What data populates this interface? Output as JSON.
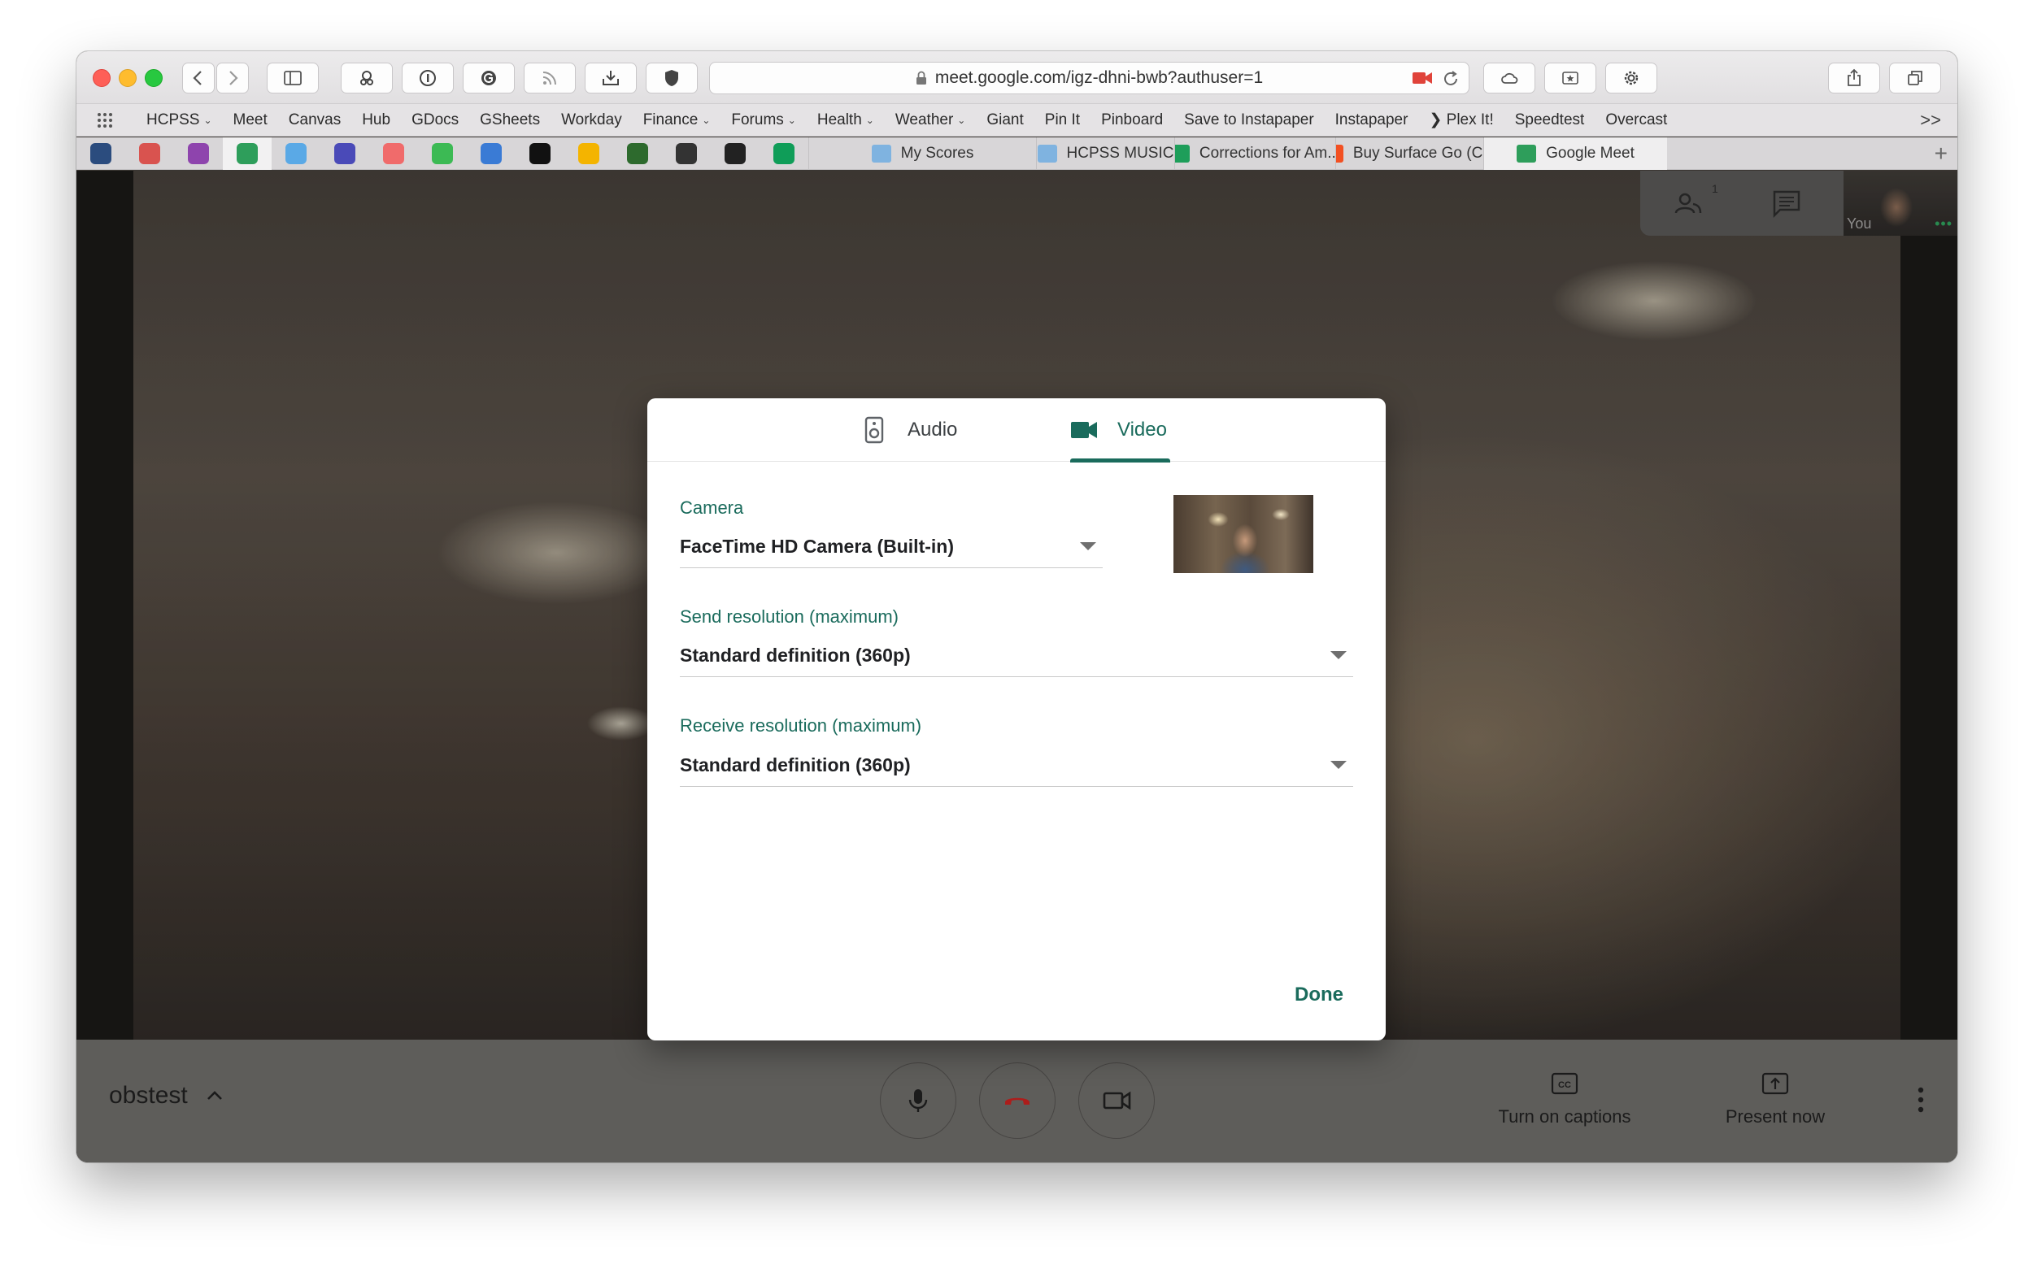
{
  "browser": {
    "url": "meet.google.com/igz-dhni-bwb?authuser=1",
    "bookmarks": [
      {
        "label": "HCPSS",
        "menu": true
      },
      {
        "label": "Meet",
        "menu": false
      },
      {
        "label": "Canvas",
        "menu": false
      },
      {
        "label": "Hub",
        "menu": false
      },
      {
        "label": "GDocs",
        "menu": false
      },
      {
        "label": "GSheets",
        "menu": false
      },
      {
        "label": "Workday",
        "menu": false
      },
      {
        "label": "Finance",
        "menu": true
      },
      {
        "label": "Forums",
        "menu": true
      },
      {
        "label": "Health",
        "menu": true
      },
      {
        "label": "Weather",
        "menu": true
      },
      {
        "label": "Giant",
        "menu": false
      },
      {
        "label": "Pin It",
        "menu": false
      },
      {
        "label": "Pinboard",
        "menu": false
      },
      {
        "label": "Save to Instapaper",
        "menu": false
      },
      {
        "label": "Instapaper",
        "menu": false
      },
      {
        "label": "❯ Plex It!",
        "menu": false
      },
      {
        "label": "Speedtest",
        "menu": false
      },
      {
        "label": "Overcast",
        "menu": false
      }
    ],
    "bookmarks_more": ">>",
    "tabs": [
      {
        "label": "My Scores",
        "icon": "folder-icon"
      },
      {
        "label": "HCPSS MUSIC",
        "icon": "folder-icon"
      },
      {
        "label": "Corrections for Am...",
        "icon": "sheets-icon"
      },
      {
        "label": "Buy Surface Go (C...",
        "icon": "microsoft-icon"
      },
      {
        "label": "Google Meet",
        "icon": "meet-icon"
      }
    ],
    "pinned_tab_colors": [
      "#2b4c7e",
      "#d9534f",
      "#8e44ad",
      "#2e9e5b",
      "#5aa9e6",
      "#4a4ab8",
      "#f06b6b",
      "#3cba54",
      "#3a7bd5",
      "#111111",
      "#f4b400",
      "#2d6a2d",
      "#333333",
      "#222222",
      "#0f9d58"
    ],
    "active_pinned_index": 3
  },
  "meet": {
    "participant_count": "1",
    "self_label": "You",
    "self_more": "•••",
    "meeting_code": "obstest",
    "captions_label": "Turn on captions",
    "present_label": "Present now"
  },
  "dialog": {
    "tab_audio": "Audio",
    "tab_video": "Video",
    "camera_label": "Camera",
    "camera_value": "FaceTime HD Camera (Built-in)",
    "send_label": "Send resolution (maximum)",
    "send_value": "Standard definition (360p)",
    "receive_label": "Receive resolution (maximum)",
    "receive_value": "Standard definition (360p)",
    "done_label": "Done"
  },
  "colors": {
    "accent": "#1a6b5c",
    "hangup": "#c5221f"
  }
}
